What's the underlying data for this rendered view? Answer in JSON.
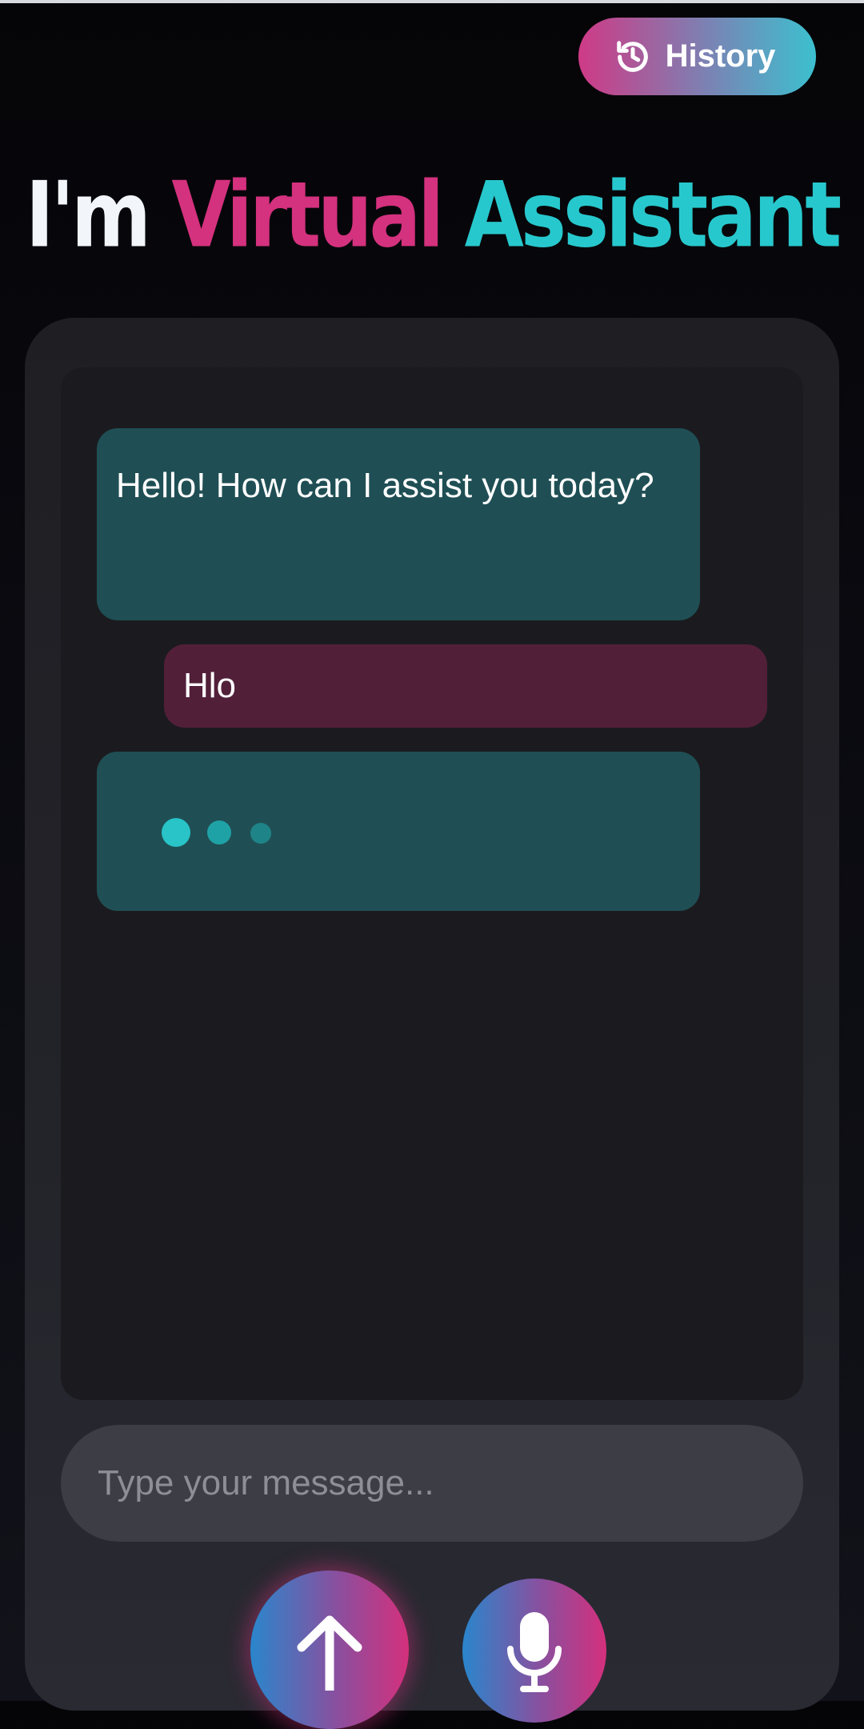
{
  "header": {
    "history_label": "History",
    "history_icon": "history-icon"
  },
  "hero": {
    "prefix": "I'm ",
    "highlight1": "Virtual",
    "highlight2": "Assistant"
  },
  "chat": {
    "messages": [
      {
        "role": "assistant",
        "text": "Hello! How can I assist you today?"
      },
      {
        "role": "user",
        "text": "Hlo"
      },
      {
        "role": "assistant",
        "typing": true
      }
    ]
  },
  "composer": {
    "placeholder": "Type your message...",
    "value": "",
    "send_icon": "arrow-up-icon",
    "mic_icon": "microphone-icon"
  },
  "colors": {
    "accent_pink": "#d4317e",
    "accent_cyan": "#27c8cd",
    "bot_bubble": "#1f4f54",
    "user_bubble": "#521f39"
  }
}
